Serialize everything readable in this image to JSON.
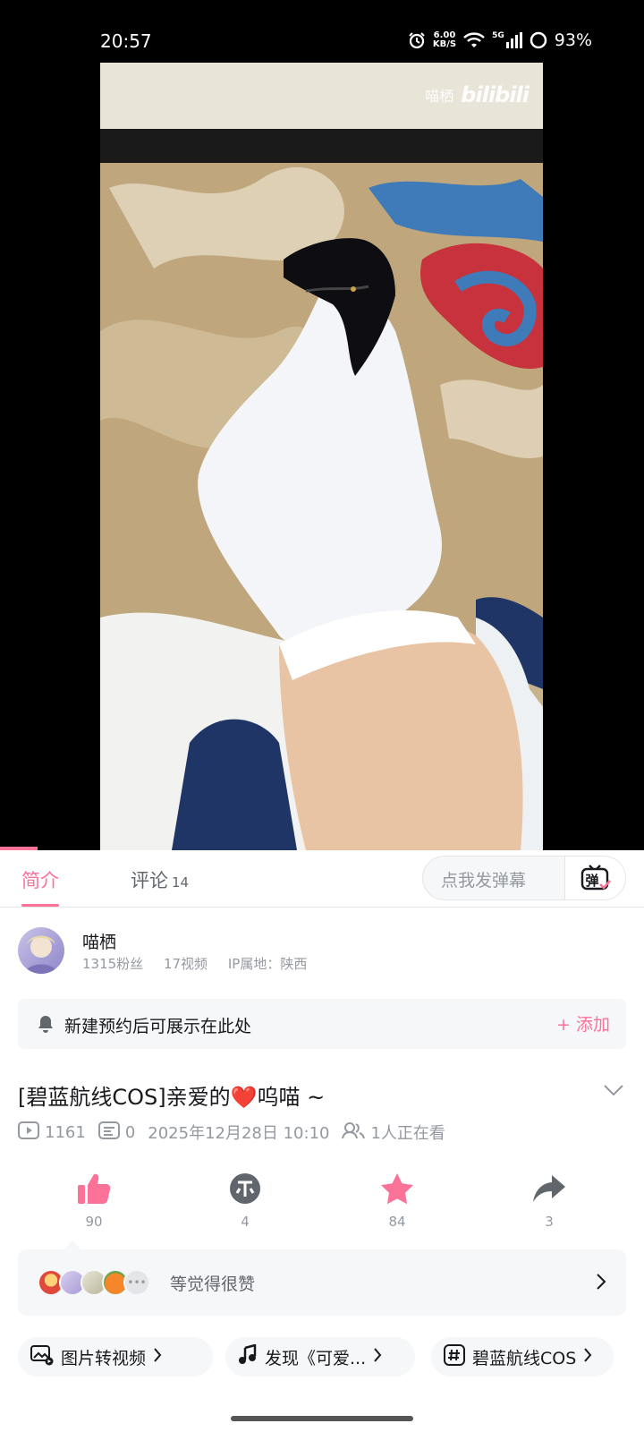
{
  "status_bar": {
    "time": "20:57",
    "net_speed": "6.00",
    "net_unit": "KB/S",
    "signal_label": "5G",
    "battery": "93%"
  },
  "video": {
    "watermark_name": "喵栖",
    "watermark_logo": "bilibili"
  },
  "tabs": {
    "intro_label": "简介",
    "comments_label": "评论",
    "comments_count": "14",
    "danmaku_placeholder": "点我发弹幕",
    "danmaku_icon_label": "弹"
  },
  "uploader": {
    "name": "喵栖",
    "fans": "1315粉丝",
    "videos": "17视频",
    "ip": "IP属地：陕西"
  },
  "reservation": {
    "text": "新建预约后可展示在此处",
    "add_label": "+ 添加"
  },
  "video_info": {
    "title": "[碧蓝航线COS]亲爱的❤️呜喵 ~",
    "plays": "1161",
    "danmaku_count": "0",
    "date": "2025年12月28日 10:10",
    "watching": "1人正在看"
  },
  "actions": {
    "like_count": "90",
    "coin_count": "4",
    "fav_count": "84",
    "share_count": "3"
  },
  "likers": {
    "text": "等觉得很赞"
  },
  "chips": [
    {
      "label": "图片转视频"
    },
    {
      "label": "发现《可爱..."
    },
    {
      "label": "碧蓝航线COS"
    }
  ],
  "colors": {
    "accent": "#fb7299",
    "muted": "#9499a0",
    "panel_bg": "#f6f7f8"
  }
}
